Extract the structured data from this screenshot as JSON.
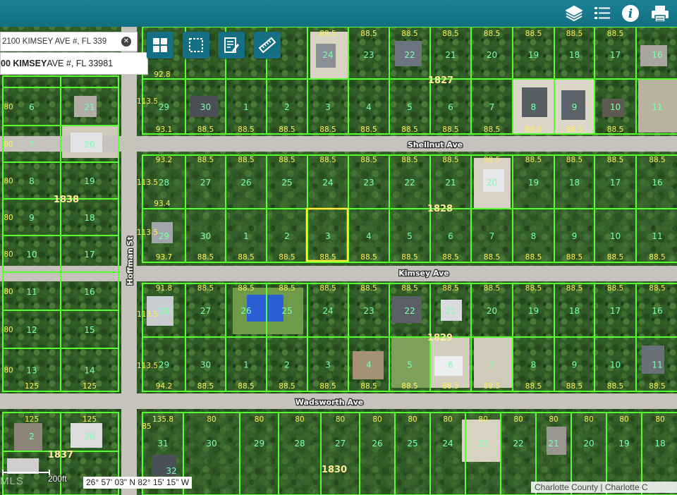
{
  "toolbar": {
    "icons": [
      "layers-icon",
      "legend-list-icon",
      "info-icon",
      "print-icon"
    ]
  },
  "search": {
    "value": "2100 KIMSEY AVE #, FL 339",
    "result_bold": "00 KIMSEY",
    "result_rest": " AVE #, FL 33981"
  },
  "map_tools": [
    "grid-icon",
    "select-icon",
    "edit-icon",
    "measure-icon"
  ],
  "streets": {
    "shellnut": "Shellnut Ave",
    "kimsey": "Kimsey Ave",
    "wadsworth": "Wadsworth Ave",
    "hoffman": "Hoffman St"
  },
  "blocks": [
    "1827",
    "1838",
    "1828",
    "1829",
    "1837",
    "1830"
  ],
  "coords": "26° 57' 03\" N 82° 15' 15\" W",
  "attribution": "Charlotte County | Charlotte C",
  "scale": "200ft",
  "watermark": "MLS",
  "selected_parcel": "3",
  "colors": {
    "toolbar": "#136f82",
    "parcel_line": "#56ff2e",
    "selected": "#ffee33",
    "lot_label": "#7dffb0",
    "dim_label": "#ffef5a"
  },
  "map": {
    "row_top": {
      "lots": [
        "24",
        "23",
        "22",
        "21",
        "20",
        "19",
        "18",
        "17",
        "16"
      ],
      "front": [
        "88.5",
        "88.5",
        "88.5",
        "88.5",
        "88.5",
        "88.5",
        "88.5",
        "88.5"
      ]
    },
    "row_a": {
      "lots": [
        "29",
        "30",
        "1",
        "2",
        "3",
        "4",
        "5",
        "6",
        "7",
        "8",
        "9",
        "10",
        "11"
      ],
      "front": [
        "93.1",
        "88.5",
        "88.5",
        "88.5",
        "88.5",
        "88.5",
        "88.5",
        "88.5",
        "88.5",
        "88.5",
        "88.5",
        "88.5"
      ]
    },
    "row_b": {
      "lots": [
        "28",
        "27",
        "26",
        "25",
        "24",
        "23",
        "22",
        "21",
        "20",
        "19",
        "18",
        "17",
        "16"
      ],
      "front": [
        "93.2",
        "88.5",
        "88.5",
        "88.5",
        "88.5",
        "88.5",
        "88.5",
        "88.5",
        "88.5",
        "88.5",
        "88.5",
        "88.5",
        "88.5"
      ]
    },
    "row_c": {
      "lots": [
        "29",
        "30",
        "1",
        "2",
        "3",
        "4",
        "5",
        "6",
        "7",
        "8",
        "9",
        "10",
        "11"
      ],
      "front": [
        "93.7",
        "88.5",
        "88.5",
        "88.5",
        "88.5",
        "88.5",
        "88.5",
        "88.5",
        "88.5",
        "88.5",
        "88.5",
        "88.5",
        "88.5"
      ]
    },
    "row_d": {
      "lots": [
        "28",
        "27",
        "26",
        "25",
        "24",
        "23",
        "22",
        "21",
        "20",
        "19",
        "18",
        "17",
        "16"
      ],
      "front": [
        "91.8",
        "88.5",
        "88.5",
        "88.5",
        "88.5",
        "88.5",
        "88.5",
        "88.5",
        "88.5",
        "88.5",
        "88.5",
        "88.5",
        "88.5"
      ]
    },
    "row_e": {
      "lots": [
        "29",
        "30",
        "1",
        "2",
        "3",
        "4",
        "5",
        "6",
        "7",
        "8",
        "9",
        "10",
        "11"
      ],
      "front": [
        "94.2",
        "88.5",
        "88.5",
        "88.5",
        "88.5",
        "88.5",
        "88.5",
        "88.5",
        "88.5",
        "88.5",
        "88.5",
        "88.5",
        "88.5"
      ]
    },
    "row_f": {
      "lots": [
        "31",
        "30",
        "29",
        "28",
        "27",
        "26",
        "25",
        "24",
        "23",
        "22",
        "21",
        "20",
        "19",
        "18"
      ],
      "front": [
        "135.8",
        "80",
        "80",
        "80",
        "80",
        "80",
        "80",
        "80",
        "80",
        "80",
        "80",
        "80",
        "80",
        "80"
      ]
    },
    "left_col": {
      "lots": [
        "6",
        "7",
        "8",
        "9",
        "10",
        "11",
        "12",
        "13"
      ],
      "right_lots": [
        "21",
        "20",
        "19",
        "18",
        "17",
        "16",
        "15",
        "14"
      ],
      "front": [
        "125",
        "125"
      ],
      "side": [
        "80",
        "80",
        "80",
        "80",
        "80",
        "80",
        "80",
        "80"
      ]
    },
    "side_labels": [
      "113.5",
      "113.5",
      "113.5",
      "113.5",
      "113.5",
      "92.8",
      "93.4",
      "80",
      "85"
    ],
    "bottom_left": {
      "lots": [
        "2",
        "26",
        "32"
      ],
      "front": [
        "125",
        "125"
      ],
      "block": "1837"
    }
  }
}
